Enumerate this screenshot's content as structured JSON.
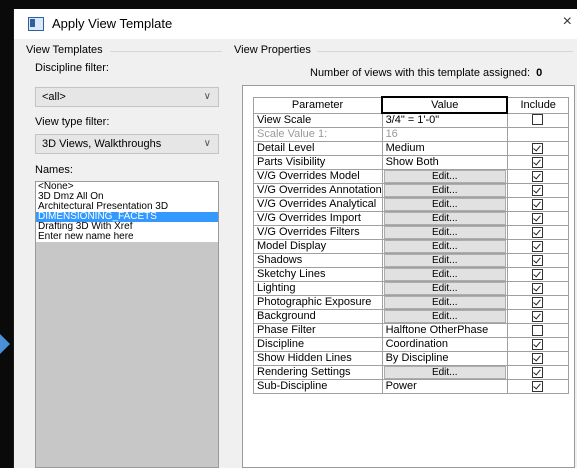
{
  "window": {
    "title": "Apply View Template",
    "close_glyph": "×"
  },
  "left": {
    "group_title": "View Templates",
    "discipline_label": "Discipline filter:",
    "discipline_value": "<all>",
    "viewtype_label": "View type filter:",
    "viewtype_value": "3D Views, Walkthroughs",
    "names_label": "Names:",
    "names": [
      {
        "label": "<None>",
        "selected": false
      },
      {
        "label": "3D Dmz All On",
        "selected": false
      },
      {
        "label": "Architectural Presentation 3D",
        "selected": false
      },
      {
        "label": "DIMENSIONING_FACETS",
        "selected": true
      },
      {
        "label": "Drafting 3D With Xref",
        "selected": false
      },
      {
        "label": "Enter new name here",
        "selected": false
      }
    ]
  },
  "right": {
    "group_title": "View Properties",
    "count_label": "Number of views with this template assigned:",
    "count_value": "0",
    "columns": [
      "Parameter",
      "Value",
      "Include"
    ],
    "rows": [
      {
        "param": "View Scale",
        "value": "3/4\" = 1'-0\"",
        "edit": false,
        "include": false,
        "disabled": false
      },
      {
        "param": "Scale Value   1:",
        "value": "16",
        "edit": false,
        "include": null,
        "disabled": true
      },
      {
        "param": "Detail Level",
        "value": "Medium",
        "edit": false,
        "include": true,
        "disabled": false
      },
      {
        "param": "Parts Visibility",
        "value": "Show Both",
        "edit": false,
        "include": true,
        "disabled": false
      },
      {
        "param": "V/G Overrides Model",
        "value": "Edit...",
        "edit": true,
        "include": true,
        "disabled": false
      },
      {
        "param": "V/G Overrides Annotation",
        "value": "Edit...",
        "edit": true,
        "include": true,
        "disabled": false
      },
      {
        "param": "V/G Overrides Analytical",
        "value": "Edit...",
        "edit": true,
        "include": true,
        "disabled": false
      },
      {
        "param": "V/G Overrides Import",
        "value": "Edit...",
        "edit": true,
        "include": true,
        "disabled": false
      },
      {
        "param": "V/G Overrides Filters",
        "value": "Edit...",
        "edit": true,
        "include": true,
        "disabled": false
      },
      {
        "param": "Model Display",
        "value": "Edit...",
        "edit": true,
        "include": true,
        "disabled": false
      },
      {
        "param": "Shadows",
        "value": "Edit...",
        "edit": true,
        "include": true,
        "disabled": false
      },
      {
        "param": "Sketchy Lines",
        "value": "Edit...",
        "edit": true,
        "include": true,
        "disabled": false
      },
      {
        "param": "Lighting",
        "value": "Edit...",
        "edit": true,
        "include": true,
        "disabled": false
      },
      {
        "param": "Photographic Exposure",
        "value": "Edit...",
        "edit": true,
        "include": true,
        "disabled": false
      },
      {
        "param": "Background",
        "value": "Edit...",
        "edit": true,
        "include": true,
        "disabled": false
      },
      {
        "param": "Phase Filter",
        "value": "Halftone OtherPhase",
        "edit": false,
        "include": false,
        "disabled": false
      },
      {
        "param": "Discipline",
        "value": "Coordination",
        "edit": false,
        "include": true,
        "disabled": false
      },
      {
        "param": "Show Hidden Lines",
        "value": "By Discipline",
        "edit": false,
        "include": true,
        "disabled": false
      },
      {
        "param": "Rendering Settings",
        "value": "Edit...",
        "edit": true,
        "include": true,
        "disabled": false
      },
      {
        "param": "Sub-Discipline",
        "value": "Power",
        "edit": false,
        "include": true,
        "disabled": false
      }
    ]
  },
  "colors": {
    "selection": "#3399ff",
    "dialog_bg": "#f0f0f0",
    "arrow": "#4a90d9"
  }
}
